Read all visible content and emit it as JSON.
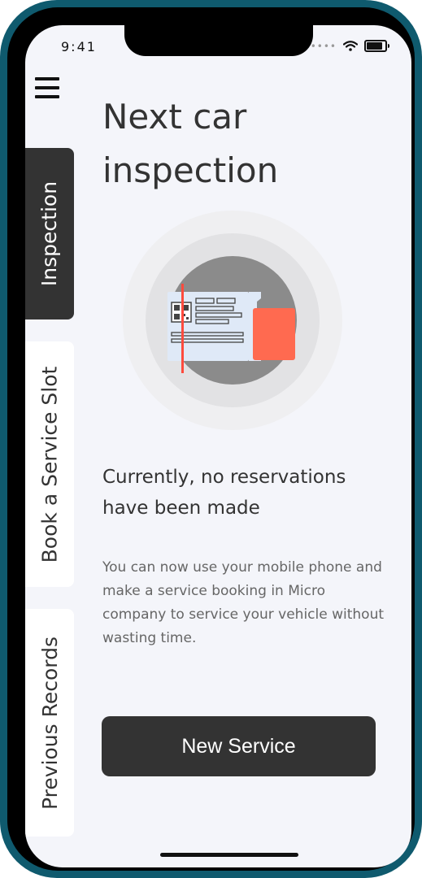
{
  "status": {
    "time": "9:41",
    "icons": [
      "signal-dots-icon",
      "wifi-icon",
      "battery-icon"
    ]
  },
  "nav": {
    "menu_icon": "hamburger-menu-icon",
    "tabs": [
      {
        "label": "Inspection",
        "active": true
      },
      {
        "label": "Book a Service Slot",
        "active": false
      },
      {
        "label": "Previous Records",
        "active": false
      }
    ]
  },
  "main": {
    "title": "Next car inspection",
    "illustration_icon": "inspection-ticket-icon",
    "empty_title": "Currently, no reservations have been made",
    "description": "You can now use your mobile phone and make a service booking in Micro company to service your vehicle without wasting time.",
    "cta_label": "New Service"
  },
  "colors": {
    "frame": "#0f5a6e",
    "background": "#f4f5fa",
    "active_tab": "#333333",
    "accent": "#ff6a50",
    "text_primary": "#333333",
    "text_secondary": "#666666"
  }
}
